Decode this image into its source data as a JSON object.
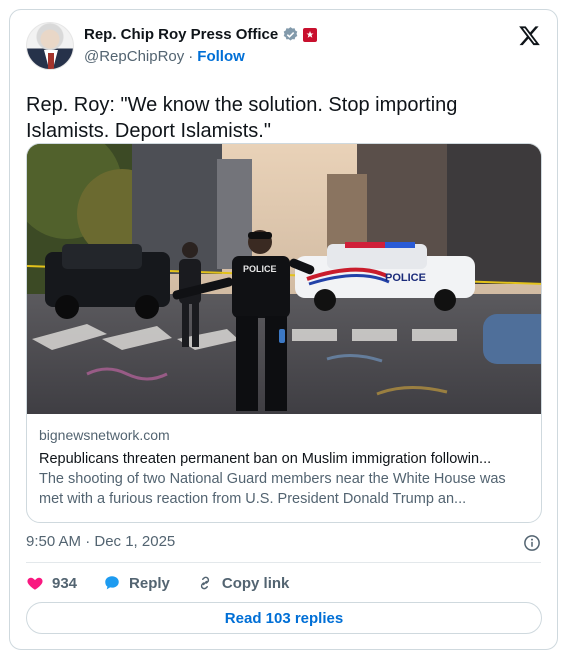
{
  "author": {
    "name": "Rep. Chip Roy Press Office",
    "handle": "@RepChipRoy",
    "separator": "·",
    "follow_label": "Follow"
  },
  "tweet": {
    "text": "Rep. Roy: \"We know the solution. Stop importing Islamists. Deport Islamists.\"",
    "timestamp": "9:50 AM · Dec 1, 2025"
  },
  "link_card": {
    "domain": "bignewsnetwork.com",
    "title": "Republicans threaten permanent ban on Muslim immigration followin...",
    "description": "The shooting of two National Guard members near the White House was met with a furious reaction from U.S. President Donald Trump an...",
    "image_text": {
      "officer_vest": "POLICE",
      "car_label": "POLICE"
    }
  },
  "actions": {
    "like_count": "934",
    "reply_label": "Reply",
    "copy_link_label": "Copy link",
    "read_replies_label": "Read 103 replies"
  },
  "colors": {
    "accent": "#006fd6",
    "like": "#f91880",
    "reply": "#1d9bf0",
    "text_secondary": "#536471",
    "border": "#cfd9de"
  },
  "icons": [
    "verified-badge-icon",
    "congress-flag-icon",
    "x-logo-icon",
    "info-icon",
    "heart-icon",
    "reply-bubble-icon",
    "link-icon"
  ]
}
